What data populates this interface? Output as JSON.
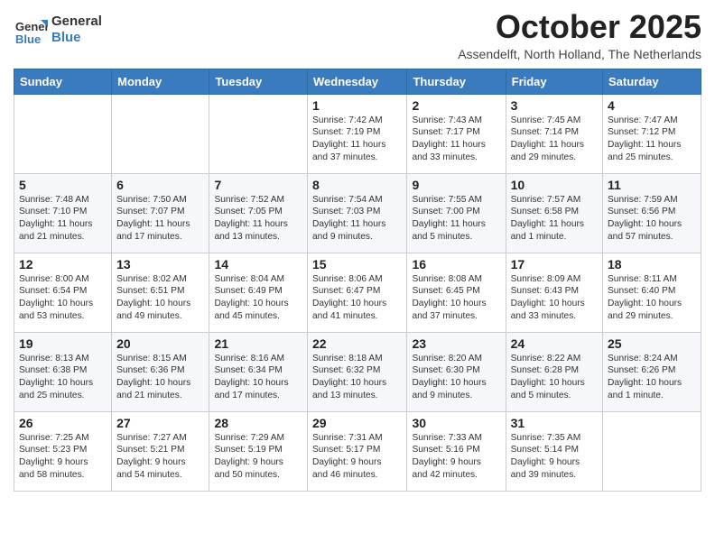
{
  "logo": {
    "general": "General",
    "blue": "Blue"
  },
  "header": {
    "month": "October 2025",
    "location": "Assendelft, North Holland, The Netherlands"
  },
  "weekdays": [
    "Sunday",
    "Monday",
    "Tuesday",
    "Wednesday",
    "Thursday",
    "Friday",
    "Saturday"
  ],
  "weeks": [
    [
      {
        "day": "",
        "info": ""
      },
      {
        "day": "",
        "info": ""
      },
      {
        "day": "",
        "info": ""
      },
      {
        "day": "1",
        "info": "Sunrise: 7:42 AM\nSunset: 7:19 PM\nDaylight: 11 hours\nand 37 minutes."
      },
      {
        "day": "2",
        "info": "Sunrise: 7:43 AM\nSunset: 7:17 PM\nDaylight: 11 hours\nand 33 minutes."
      },
      {
        "day": "3",
        "info": "Sunrise: 7:45 AM\nSunset: 7:14 PM\nDaylight: 11 hours\nand 29 minutes."
      },
      {
        "day": "4",
        "info": "Sunrise: 7:47 AM\nSunset: 7:12 PM\nDaylight: 11 hours\nand 25 minutes."
      }
    ],
    [
      {
        "day": "5",
        "info": "Sunrise: 7:48 AM\nSunset: 7:10 PM\nDaylight: 11 hours\nand 21 minutes."
      },
      {
        "day": "6",
        "info": "Sunrise: 7:50 AM\nSunset: 7:07 PM\nDaylight: 11 hours\nand 17 minutes."
      },
      {
        "day": "7",
        "info": "Sunrise: 7:52 AM\nSunset: 7:05 PM\nDaylight: 11 hours\nand 13 minutes."
      },
      {
        "day": "8",
        "info": "Sunrise: 7:54 AM\nSunset: 7:03 PM\nDaylight: 11 hours\nand 9 minutes."
      },
      {
        "day": "9",
        "info": "Sunrise: 7:55 AM\nSunset: 7:00 PM\nDaylight: 11 hours\nand 5 minutes."
      },
      {
        "day": "10",
        "info": "Sunrise: 7:57 AM\nSunset: 6:58 PM\nDaylight: 11 hours\nand 1 minute."
      },
      {
        "day": "11",
        "info": "Sunrise: 7:59 AM\nSunset: 6:56 PM\nDaylight: 10 hours\nand 57 minutes."
      }
    ],
    [
      {
        "day": "12",
        "info": "Sunrise: 8:00 AM\nSunset: 6:54 PM\nDaylight: 10 hours\nand 53 minutes."
      },
      {
        "day": "13",
        "info": "Sunrise: 8:02 AM\nSunset: 6:51 PM\nDaylight: 10 hours\nand 49 minutes."
      },
      {
        "day": "14",
        "info": "Sunrise: 8:04 AM\nSunset: 6:49 PM\nDaylight: 10 hours\nand 45 minutes."
      },
      {
        "day": "15",
        "info": "Sunrise: 8:06 AM\nSunset: 6:47 PM\nDaylight: 10 hours\nand 41 minutes."
      },
      {
        "day": "16",
        "info": "Sunrise: 8:08 AM\nSunset: 6:45 PM\nDaylight: 10 hours\nand 37 minutes."
      },
      {
        "day": "17",
        "info": "Sunrise: 8:09 AM\nSunset: 6:43 PM\nDaylight: 10 hours\nand 33 minutes."
      },
      {
        "day": "18",
        "info": "Sunrise: 8:11 AM\nSunset: 6:40 PM\nDaylight: 10 hours\nand 29 minutes."
      }
    ],
    [
      {
        "day": "19",
        "info": "Sunrise: 8:13 AM\nSunset: 6:38 PM\nDaylight: 10 hours\nand 25 minutes."
      },
      {
        "day": "20",
        "info": "Sunrise: 8:15 AM\nSunset: 6:36 PM\nDaylight: 10 hours\nand 21 minutes."
      },
      {
        "day": "21",
        "info": "Sunrise: 8:16 AM\nSunset: 6:34 PM\nDaylight: 10 hours\nand 17 minutes."
      },
      {
        "day": "22",
        "info": "Sunrise: 8:18 AM\nSunset: 6:32 PM\nDaylight: 10 hours\nand 13 minutes."
      },
      {
        "day": "23",
        "info": "Sunrise: 8:20 AM\nSunset: 6:30 PM\nDaylight: 10 hours\nand 9 minutes."
      },
      {
        "day": "24",
        "info": "Sunrise: 8:22 AM\nSunset: 6:28 PM\nDaylight: 10 hours\nand 5 minutes."
      },
      {
        "day": "25",
        "info": "Sunrise: 8:24 AM\nSunset: 6:26 PM\nDaylight: 10 hours\nand 1 minute."
      }
    ],
    [
      {
        "day": "26",
        "info": "Sunrise: 7:25 AM\nSunset: 5:23 PM\nDaylight: 9 hours\nand 58 minutes."
      },
      {
        "day": "27",
        "info": "Sunrise: 7:27 AM\nSunset: 5:21 PM\nDaylight: 9 hours\nand 54 minutes."
      },
      {
        "day": "28",
        "info": "Sunrise: 7:29 AM\nSunset: 5:19 PM\nDaylight: 9 hours\nand 50 minutes."
      },
      {
        "day": "29",
        "info": "Sunrise: 7:31 AM\nSunset: 5:17 PM\nDaylight: 9 hours\nand 46 minutes."
      },
      {
        "day": "30",
        "info": "Sunrise: 7:33 AM\nSunset: 5:16 PM\nDaylight: 9 hours\nand 42 minutes."
      },
      {
        "day": "31",
        "info": "Sunrise: 7:35 AM\nSunset: 5:14 PM\nDaylight: 9 hours\nand 39 minutes."
      },
      {
        "day": "",
        "info": ""
      }
    ]
  ]
}
